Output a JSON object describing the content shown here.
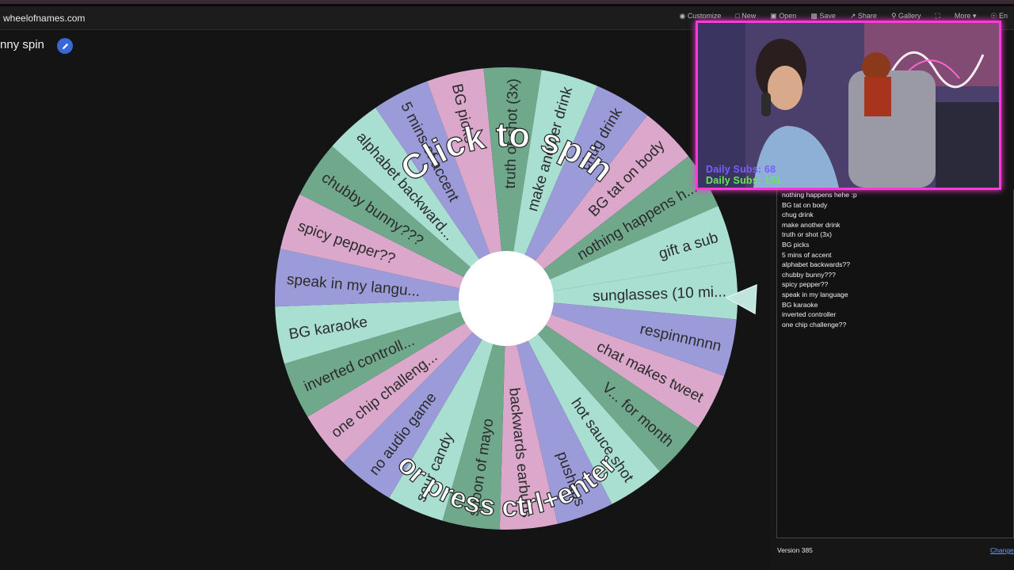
{
  "browser": {
    "url": "wheelofnames.com"
  },
  "toolbar": [
    {
      "label": "Customize",
      "icon": "palette-icon"
    },
    {
      "label": "New",
      "icon": "new-file-icon"
    },
    {
      "label": "Open",
      "icon": "folder-icon"
    },
    {
      "label": "Save",
      "icon": "save-icon"
    },
    {
      "label": "Share",
      "icon": "share-icon"
    },
    {
      "label": "Gallery",
      "icon": "search-icon"
    },
    {
      "label": "",
      "icon": "fullscreen-icon"
    },
    {
      "label": "More",
      "icon": "chevron-down-icon"
    },
    {
      "label": "En",
      "icon": "globe-icon"
    }
  ],
  "wheel": {
    "title": "nny spin",
    "click_text": "Click to spin",
    "press_text": "or press ctrl+enter",
    "colors": [
      "#a9dfd1",
      "#9b9bd9",
      "#dba8cc",
      "#6fa88a"
    ],
    "center_color": "#ffffff",
    "slices": [
      "sunglasses (10 mi...",
      "respinnnnnn",
      "chat makes tweet",
      "V... for month",
      "hot sauce shot",
      "pushups",
      "backwards earbuds",
      "spoon of mayo",
      "sour candy",
      "no audio game",
      "one chip challeng...",
      "inverted controll...",
      "BG karaoke",
      "speak in my langu...",
      "spicy pepper??",
      "chubby bunny???",
      "alphabet backward...",
      "5 mins of accent",
      "BG picks",
      "truth or shot (3x)",
      "make another drink",
      "chug drink",
      "BG tat on body",
      "nothing happens h...",
      "gift a sub"
    ]
  },
  "entries": [
    "nothing happens hehe :p",
    "BG tat on body",
    "chug drink",
    "make another drink",
    "truth or shot (3x)",
    "BG picks",
    "5 mins of accent",
    "alphabet backwards??",
    "chubby bunny???",
    "spicy pepper??",
    "speak in my language",
    "BG karaoke",
    "inverted controller",
    "one chip challenge??"
  ],
  "footer": {
    "version": "Version 385",
    "changelog": "Changel"
  },
  "overlay": {
    "daily_subs_1": "Daily Subs: 68",
    "daily_subs_2": "Daily Subs: 151"
  }
}
